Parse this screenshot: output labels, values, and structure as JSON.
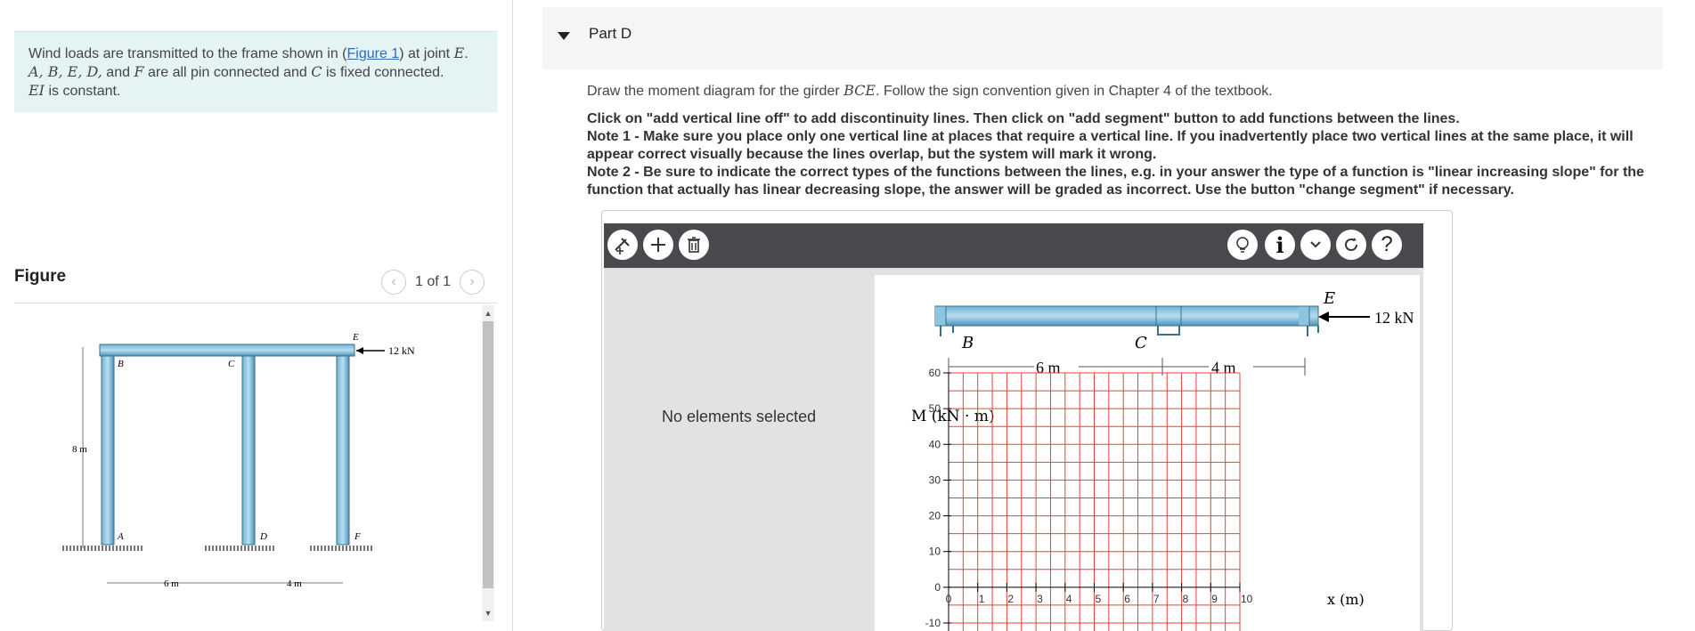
{
  "problem": {
    "text_a": "Wind loads are transmitted to the frame shown in (",
    "figure_link": "Figure 1",
    "text_b": ") at joint ",
    "joint_e": "E",
    "text_c": ".",
    "line2_joints": "A, B, E, D,",
    "line2_and": " and ",
    "line2_f": "F",
    "line2_mid": " are all pin connected and ",
    "line2_c": "C",
    "line2_end": " is fixed connected.",
    "line3_ei": "EI",
    "line3_end": " is constant."
  },
  "figure": {
    "title": "Figure",
    "pager": "1 of 1",
    "prev_icon": "chevron-left-icon",
    "next_icon": "chevron-right-icon",
    "load_label": "12 kN",
    "height_label": "8 m",
    "span1_label": "6 m",
    "span2_label": "4 m",
    "joints": [
      "A",
      "B",
      "C",
      "D",
      "E",
      "F"
    ]
  },
  "part": {
    "title": "Part D"
  },
  "instructions": {
    "draw_a": "Draw the moment diagram for the girder ",
    "draw_girder": "BCE",
    "draw_b": ". Follow the sign convention given in Chapter 4 of the textbook.",
    "line1": "Click on \"add vertical line off\" to add discontinuity lines. Then click on \"add segment\" button to add functions between the lines.",
    "line2": "Note 1 - Make sure you place only one vertical line at places that require a vertical line. If you inadvertently place two vertical lines at the same place, it will appear correct visually because the lines overlap, but the system will mark it wrong.",
    "line3": "Note 2 - Be sure to indicate the correct types of the functions between the lines, e.g. in your answer the type of a function is \"linear increasing slope\" for the function that actually has linear decreasing slope, the answer will be graded as incorrect. Use the button \"change segment\" if necessary."
  },
  "tool": {
    "no_selection": "No elements selected",
    "toolbar_icons": [
      "add-vertical-line-icon",
      "add-segment-icon",
      "delete-icon",
      "hint-icon",
      "info-icon",
      "dropdown-icon",
      "reset-icon",
      "help-icon"
    ],
    "help_glyph": "?",
    "info_glyph": "i",
    "beam_labels": {
      "B": "B",
      "C": "C",
      "E": "E"
    },
    "load_label": "12 kN",
    "dim_1": "6 m",
    "dim_2": "4 m",
    "y_axis_label": "M (kN · m)",
    "x_axis_label": "x (m)"
  },
  "chart_data": {
    "type": "line",
    "title": "",
    "ylabel": "M (kN · m)",
    "xlabel": "x (m)",
    "xlim": [
      0,
      10
    ],
    "ylim": [
      -10,
      60
    ],
    "x_ticks": [
      "0",
      "1",
      "2",
      "3",
      "4",
      "5",
      "6",
      "7",
      "8",
      "9",
      "10"
    ],
    "y_ticks": [
      "60",
      "50",
      "40",
      "30",
      "20",
      "10",
      "0",
      "-10"
    ],
    "grid": true,
    "grid_color": "#e8403f",
    "series": []
  }
}
